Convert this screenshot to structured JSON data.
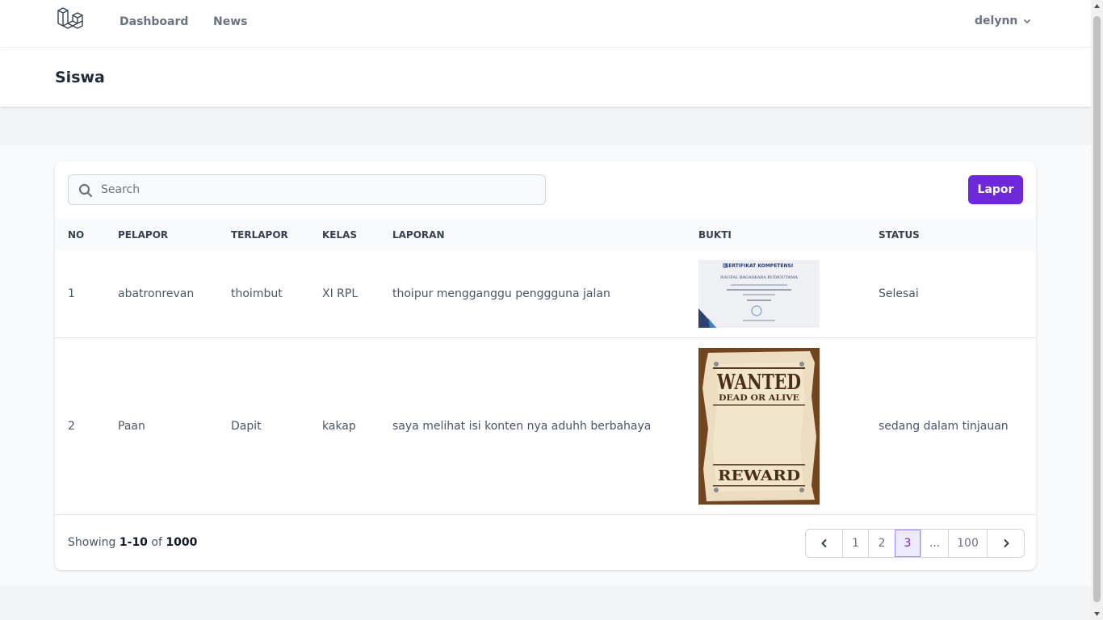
{
  "nav": {
    "dashboard_label": "Dashboard",
    "news_label": "News",
    "user_name": "delynn"
  },
  "header": {
    "title": "Siswa"
  },
  "toolbar": {
    "search_placeholder": "Search",
    "lapor_label": "Lapor"
  },
  "table": {
    "columns": [
      "NO",
      "PELAPOR",
      "TERLAPOR",
      "KELAS",
      "LAPORAN",
      "BUKTI",
      "STATUS"
    ],
    "rows": [
      {
        "no": "1",
        "pelapor": "abatronrevan",
        "terlapor": "thoimbut",
        "kelas": "XI RPL",
        "laporan": "thoipur mengganggu penggguna jalan",
        "bukti": {
          "cert_title": "SERTIFIKAT KOMPETENSI",
          "cert_name": "NAUFAL BAGASKARA BUDIOUTAMA"
        },
        "status": "Selesai"
      },
      {
        "no": "2",
        "pelapor": "Paan",
        "terlapor": "Dapit",
        "kelas": "kakap",
        "laporan": "saya melihat isi konten nya aduhh berbahaya",
        "bukti": {
          "poster_wanted": "WANTED",
          "poster_sub": "DEAD OR ALIVE",
          "poster_reward": "REWARD"
        },
        "status": "sedang dalam tinjauan"
      }
    ]
  },
  "footer": {
    "showing_prefix": "Showing",
    "showing_range": "1-10",
    "showing_of": "of",
    "showing_total": "1000"
  },
  "pagination": {
    "pages": [
      "1",
      "2",
      "3",
      "...",
      "100"
    ],
    "current": "3"
  },
  "colors": {
    "accent": "#6d28d9",
    "active_page_bg": "#ede9fe"
  }
}
